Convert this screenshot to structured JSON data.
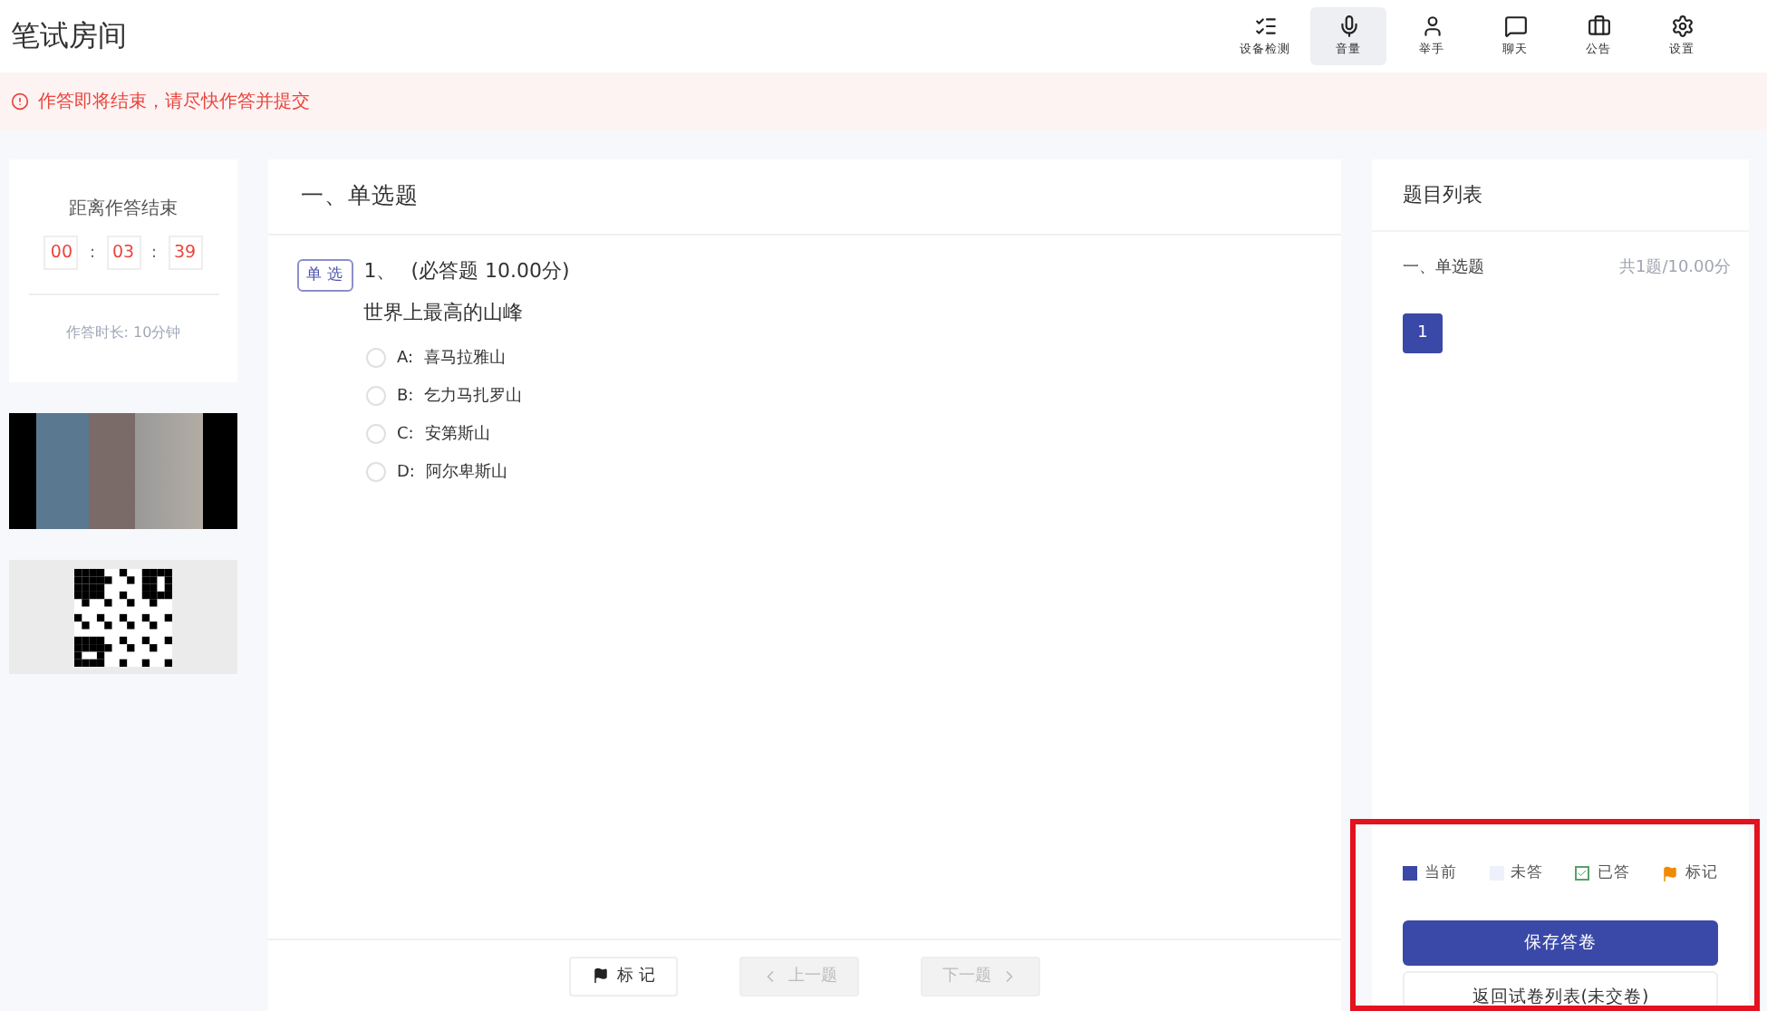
{
  "header": {
    "title": "笔试房间",
    "tools": [
      {
        "kind": "check",
        "label": "设备检测",
        "selected": false
      },
      {
        "kind": "mic",
        "label": "音量",
        "selected": true
      },
      {
        "kind": "hand",
        "label": "举手",
        "selected": false
      },
      {
        "kind": "chat",
        "label": "聊天",
        "selected": false
      },
      {
        "kind": "notice",
        "label": "公告",
        "selected": false
      },
      {
        "kind": "settings",
        "label": "设置",
        "selected": false
      }
    ]
  },
  "alert": {
    "text": "作答即将结束，请尽快作答并提交"
  },
  "timer": {
    "title": "距离作答结束",
    "parts": [
      "00",
      "03",
      "39"
    ],
    "separators": [
      ":",
      ":"
    ],
    "duration": "作答时长: 10分钟"
  },
  "section": {
    "title": "一、单选题"
  },
  "question": {
    "tag": "单 选",
    "number": "1、",
    "meta": "(必答题 10.00分)",
    "text": "世界上最高的山峰",
    "options": [
      {
        "letter": "A:",
        "text": "喜马拉雅山",
        "selected": false
      },
      {
        "letter": "B:",
        "text": "乞力马扎罗山",
        "selected": false
      },
      {
        "letter": "C:",
        "text": "安第斯山",
        "selected": false
      },
      {
        "letter": "D:",
        "text": "阿尔卑斯山",
        "selected": false
      }
    ]
  },
  "footer": {
    "buttons": [
      {
        "kind": "flag",
        "label": "标 记",
        "disabled": false
      },
      {
        "kind": "prev",
        "label": "上一题",
        "disabled": true
      },
      {
        "kind": "next",
        "label": "下一题",
        "disabled": true
      }
    ]
  },
  "question_list": {
    "title": "题目列表",
    "group": "一、单选题",
    "summary": "共1题/10.00分",
    "numbers": [
      {
        "label": "1",
        "selected": true
      }
    ],
    "legend": [
      {
        "kind": "current",
        "label": "当前"
      },
      {
        "kind": "unanswered",
        "label": "未答"
      },
      {
        "kind": "answered",
        "label": "已答"
      },
      {
        "kind": "flagged",
        "label": "标记"
      }
    ],
    "save": "保存答卷",
    "back": "返回试卷列表(未交卷)"
  }
}
